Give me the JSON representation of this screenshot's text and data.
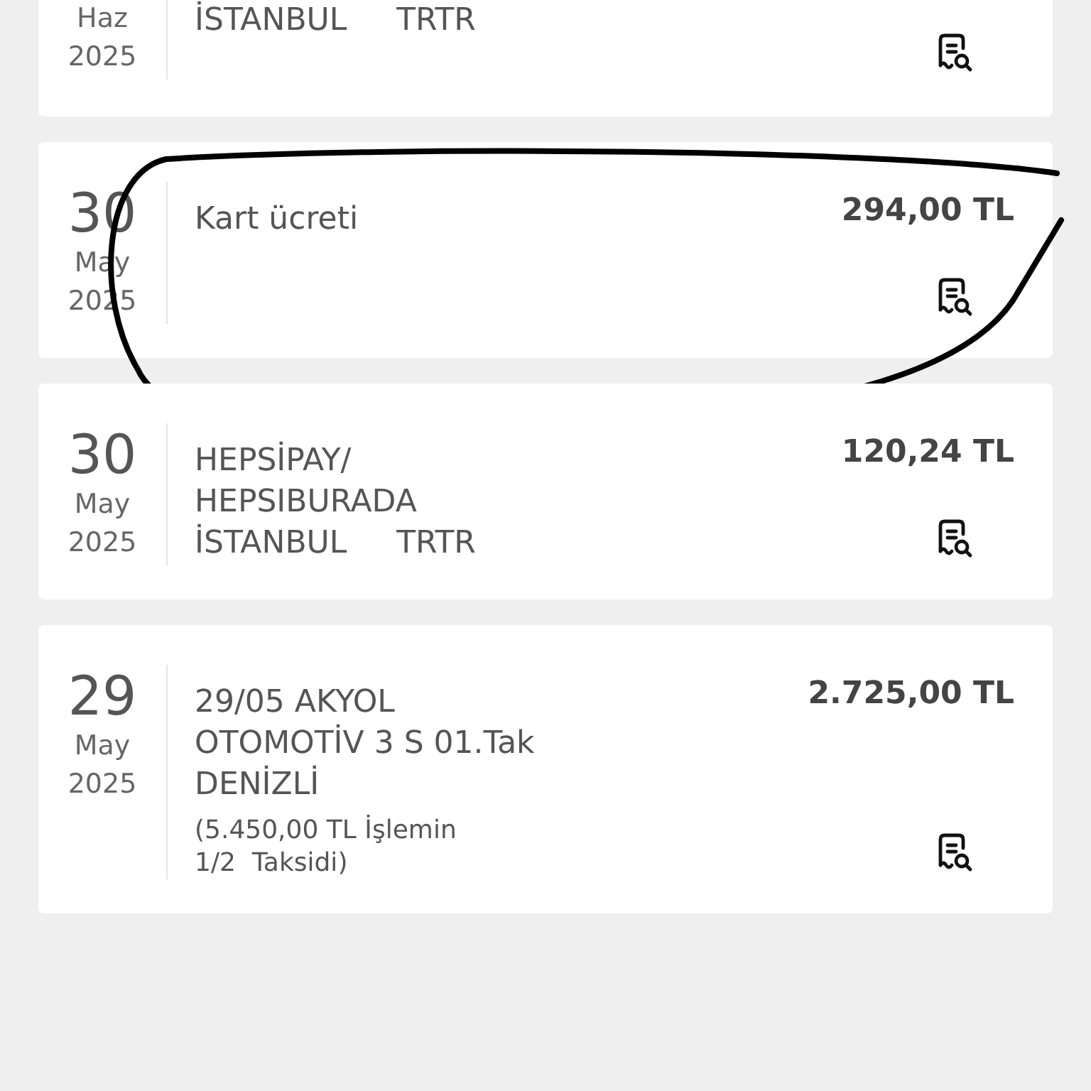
{
  "transactions": [
    {
      "date": {
        "month": "Haz",
        "year": "2025"
      },
      "description": [
        "İSTANBUL     TRTR"
      ],
      "circled": false
    },
    {
      "date": {
        "day": "30",
        "month": "May",
        "year": "2025"
      },
      "description": [
        "Kart ücreti"
      ],
      "amount": "294,00 TL",
      "circled": true
    },
    {
      "date": {
        "day": "30",
        "month": "May",
        "year": "2025"
      },
      "description": [
        "HEPSİPAY/",
        "HEPSIBURADA",
        "İSTANBUL     TRTR"
      ],
      "amount": "120,24 TL",
      "circled": false
    },
    {
      "date": {
        "day": "29",
        "month": "May",
        "year": "2025"
      },
      "description": [
        "29/05 AKYOL",
        "OTOMOTİV 3 S 01.Tak",
        "DENİZLİ"
      ],
      "note": [
        "(5.450,00 TL İşlemin",
        "1/2  Taksidi)"
      ],
      "amount": "2.725,00 TL",
      "circled": false
    }
  ]
}
